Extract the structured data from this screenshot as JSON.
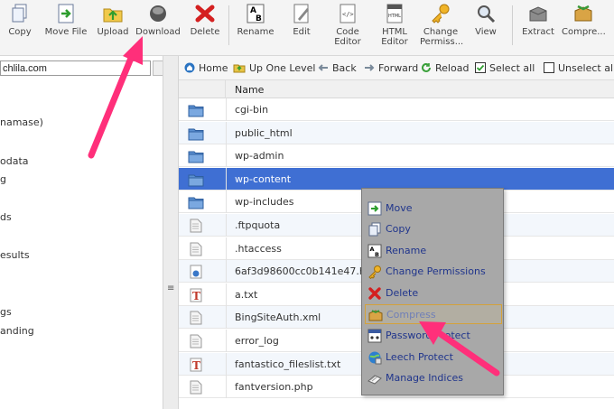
{
  "toolbar": {
    "buttons": [
      {
        "key": "copy",
        "label": "Copy",
        "icon": "copy-icon"
      },
      {
        "key": "move",
        "label": "Move File",
        "icon": "move-file-icon"
      },
      {
        "key": "upload",
        "label": "Upload",
        "icon": "upload-icon"
      },
      {
        "key": "download",
        "label": "Download",
        "icon": "download-icon"
      },
      {
        "key": "delete",
        "label": "Delete",
        "icon": "delete-icon"
      },
      {
        "key": "rename",
        "label": "Rename",
        "icon": "rename-icon"
      },
      {
        "key": "edit",
        "label": "Edit",
        "icon": "edit-icon"
      },
      {
        "key": "code",
        "label": "Code\nEditor",
        "icon": "code-editor-icon"
      },
      {
        "key": "html",
        "label": "HTML\nEditor",
        "icon": "html-editor-icon"
      },
      {
        "key": "perms",
        "label": "Change\nPermiss...",
        "icon": "change-permissions-icon"
      },
      {
        "key": "view",
        "label": "View",
        "icon": "view-icon"
      },
      {
        "key": "extract",
        "label": "Extract",
        "icon": "extract-icon"
      },
      {
        "key": "compress",
        "label": "Compre...",
        "icon": "compress-icon"
      }
    ]
  },
  "left_panel": {
    "path_value": "chlila.com",
    "tree": [
      "namase)",
      "odata",
      "g",
      "ds",
      "esults",
      "gs",
      "anding"
    ]
  },
  "navbar": {
    "home": "Home",
    "up": "Up One Level",
    "back": "Back",
    "forward": "Forward",
    "reload": "Reload",
    "select_all": "Select all",
    "unselect_all": "Unselect all"
  },
  "table": {
    "header_name": "Name",
    "files": [
      {
        "name": "cgi-bin",
        "type": "folder"
      },
      {
        "name": "public_html",
        "type": "folder"
      },
      {
        "name": "wp-admin",
        "type": "folder"
      },
      {
        "name": "wp-content",
        "type": "folder",
        "selected": true
      },
      {
        "name": "wp-includes",
        "type": "folder"
      },
      {
        "name": ".ftpquota",
        "type": "file"
      },
      {
        "name": ".htaccess",
        "type": "file"
      },
      {
        "name": "6af3d98600cc0b141e47.html",
        "type": "html"
      },
      {
        "name": "a.txt",
        "type": "text"
      },
      {
        "name": "BingSiteAuth.xml",
        "type": "file"
      },
      {
        "name": "error_log",
        "type": "file"
      },
      {
        "name": "fantastico_fileslist.txt",
        "type": "text"
      },
      {
        "name": "fantversion.php",
        "type": "file"
      }
    ]
  },
  "context_menu": {
    "items": [
      {
        "label": "Move",
        "icon": "move-icon"
      },
      {
        "label": "Copy",
        "icon": "copy-icon"
      },
      {
        "label": "Rename",
        "icon": "rename-icon"
      },
      {
        "label": "Change Permissions",
        "icon": "key-icon"
      },
      {
        "label": "Delete",
        "icon": "delete-icon"
      },
      {
        "label": "Compress",
        "icon": "compress-icon",
        "highlighted": true
      },
      {
        "label": "Password Protect",
        "icon": "password-icon"
      },
      {
        "label": "Leech Protect",
        "icon": "leech-icon"
      },
      {
        "label": "Manage Indices",
        "icon": "indices-icon"
      }
    ]
  },
  "colors": {
    "selected_row": "#3f6fd3",
    "arrow": "#ff2f7a",
    "menu_text": "#20358c",
    "highlight_border": "#d4a23a"
  }
}
